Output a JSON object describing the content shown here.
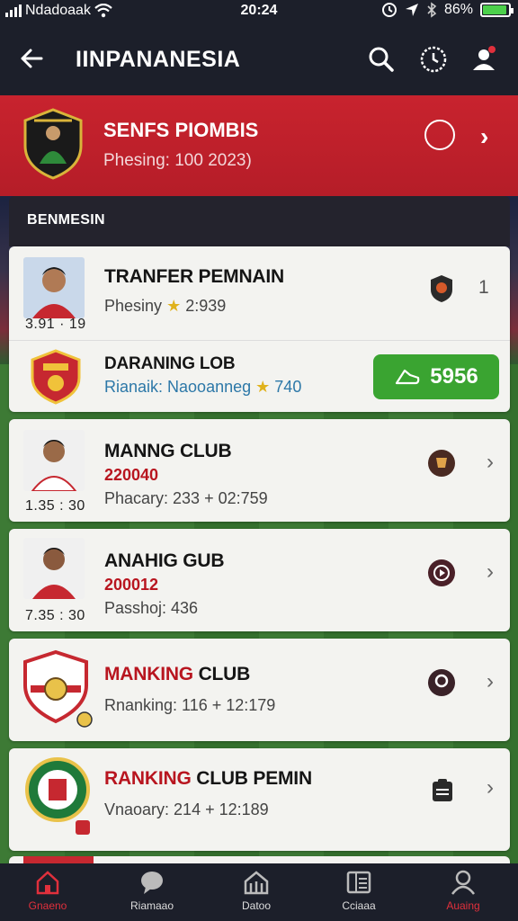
{
  "status_bar": {
    "carrier": "Ndadoaak",
    "time": "20:24",
    "battery": "86%"
  },
  "header": {
    "title": "IINPANANESIA",
    "icons": [
      "back-arrow-icon",
      "search-icon",
      "clock-icon",
      "profile-icon"
    ]
  },
  "banner": {
    "title": "SENFS PIOMBIS",
    "subtitle": "Phesing: 100 2023)"
  },
  "section": {
    "label": "BENMESIN"
  },
  "rows": [
    {
      "title": "TRANFER PEMNAIN",
      "sub_prefix": "Phesiny",
      "sub_value": "2:939",
      "time": "3.91 · 19",
      "count": "1"
    },
    {
      "title": "DARANING LOB",
      "sub_prefix": "Rianaik: Naooanneg",
      "sub_value": "740",
      "button_value": "5956"
    },
    {
      "title": "MANNG CLUB",
      "date": "220040",
      "sub": "Phacary: 233 + 02:759",
      "time": "1.35 : 30"
    },
    {
      "title": "ANAHIG GUB",
      "date": "200012",
      "sub": "Passhoj: 436",
      "time": "7.35 : 30"
    },
    {
      "title_red": "MANKING",
      "title_rest": " CLUB",
      "sub": "Rnanking: 116 + 12:179"
    },
    {
      "title_red": "RANKING",
      "title_rest": " CLUB PEMIN",
      "sub": "Vnaoary: 214 + 12:189"
    }
  ],
  "bottom_nav": [
    {
      "label": "Gnaeno",
      "icon": "home-icon"
    },
    {
      "label": "Riamaao",
      "icon": "chat-icon"
    },
    {
      "label": "Datoo",
      "icon": "stadium-icon"
    },
    {
      "label": "Cciaaa",
      "icon": "list-icon"
    },
    {
      "label": "Auaing",
      "icon": "user-icon"
    }
  ],
  "colors": {
    "banner_red": "#c8232e",
    "header_dark": "#1c1f2a",
    "accent_green": "#3aa431",
    "date_red": "#b8151f"
  }
}
